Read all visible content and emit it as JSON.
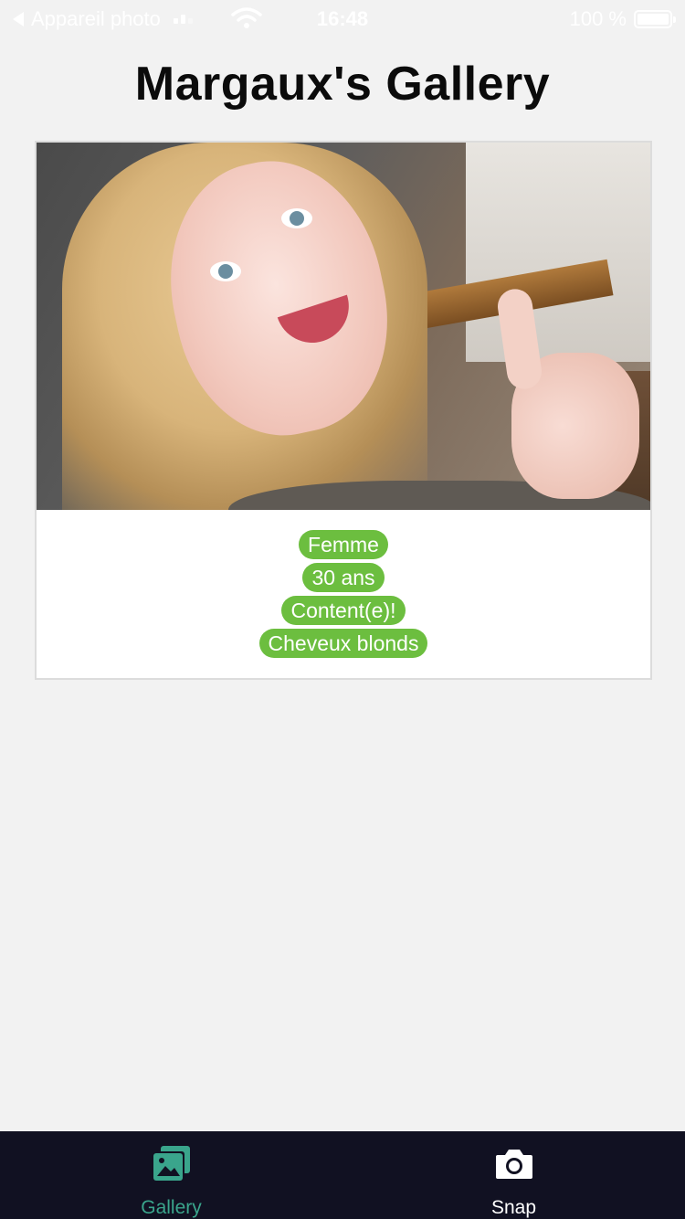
{
  "status_bar": {
    "back_label": "Appareil photo",
    "time": "16:48",
    "battery_text": "100 %"
  },
  "page": {
    "title": "Margaux's Gallery"
  },
  "card": {
    "tags": [
      "Femme",
      "30 ans",
      "Content(e)!",
      "Cheveux blonds"
    ],
    "tag_color": "#6cbe3f"
  },
  "tab_bar": {
    "tabs": [
      {
        "label": "Gallery",
        "icon": "gallery-icon",
        "active": true
      },
      {
        "label": "Snap",
        "icon": "camera-icon",
        "active": false
      }
    ],
    "active_color": "#3aa58c",
    "background": "#111122"
  }
}
